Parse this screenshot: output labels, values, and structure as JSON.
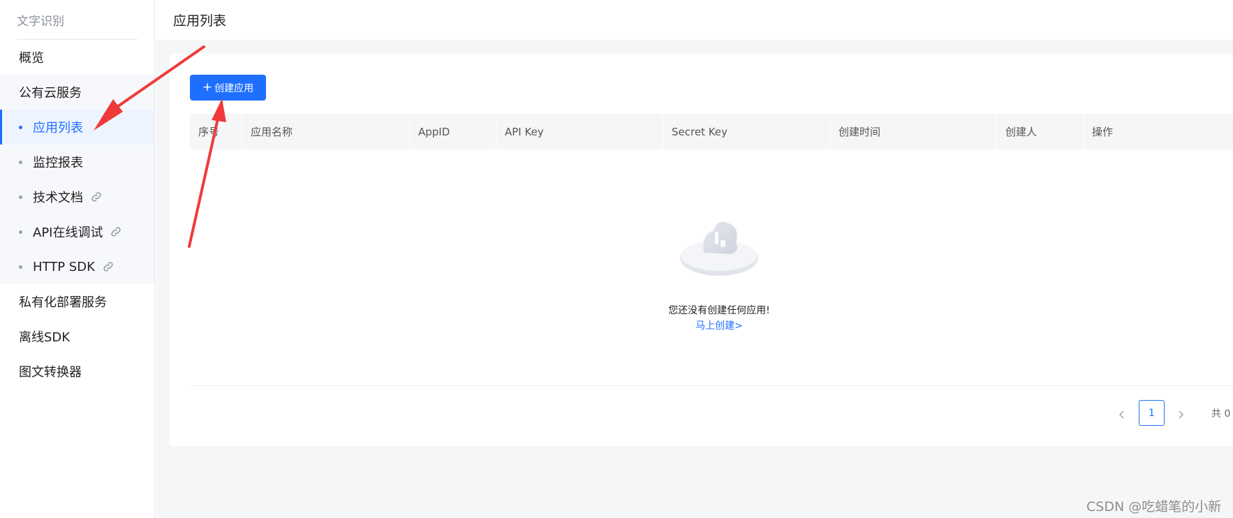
{
  "sidebar": {
    "header": "文字识别",
    "items_top": [
      {
        "label": "概览"
      }
    ],
    "group": {
      "label": "公有云服务",
      "children": [
        {
          "label": "应用列表",
          "active": true
        },
        {
          "label": "监控报表"
        },
        {
          "label": "技术文档",
          "icon": "link-icon"
        },
        {
          "label": "API在线调试",
          "icon": "link-icon"
        },
        {
          "label": "HTTP SDK",
          "icon": "link-icon"
        }
      ]
    },
    "items_bottom": [
      {
        "label": "私有化部署服务"
      },
      {
        "label": "离线SDK"
      },
      {
        "label": "图文转换器"
      }
    ]
  },
  "page": {
    "title": "应用列表"
  },
  "toolbar": {
    "create_label": "创建应用",
    "create_icon": "plus-icon"
  },
  "table": {
    "columns": [
      "序号",
      "应用名称",
      "AppID",
      "API Key",
      "Secret Key",
      "创建时间",
      "创建人",
      "操作"
    ]
  },
  "empty_state": {
    "illustration": "empty-cloud-icon",
    "message": "您还没有创建任何应用!",
    "link": "马上创建>"
  },
  "pagination": {
    "current_page": "1",
    "total": "共 0"
  },
  "watermark": "CSDN @吃蜡笔的小新",
  "colors": {
    "accent": "#1f6fff",
    "annotation_arrow": "#f03a3a"
  }
}
